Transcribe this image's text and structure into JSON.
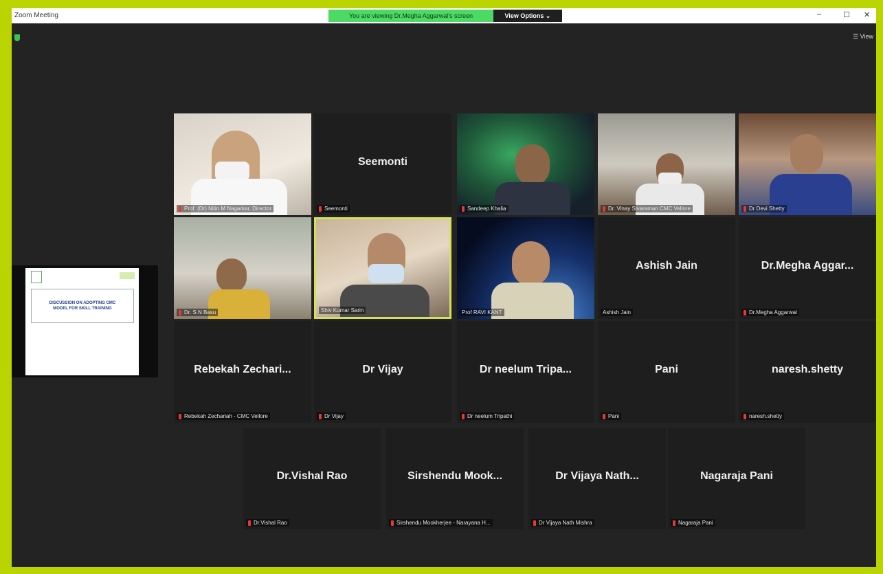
{
  "window": {
    "title": "Zoom Meeting",
    "share_banner": "You are viewing Dr.Megha Aggarwal's screen",
    "view_options": "View Options ⌄",
    "minimize": "–",
    "maximize": "☐",
    "close": "✕",
    "view_label": "☰ View"
  },
  "shared_slide": {
    "title": "DISCUSSION ON ADOPTING CMC MODEL FOR SKILL TRAINING"
  },
  "participants": [
    {
      "label": "Prof. (Dr) Nitin M Nagarkar, Director",
      "mic_muted": true
    },
    {
      "display": "Seemonti",
      "label": "Seemonti",
      "mic_muted": true
    },
    {
      "label": "Sandeep Khalia",
      "mic_muted": true
    },
    {
      "label": "Dr. Vinay Sivaraman CMC Vellore",
      "mic_muted": true
    },
    {
      "label": "Dr Devi Shetty",
      "mic_muted": true
    },
    {
      "label": "Dr. S N Basu",
      "mic_muted": true
    },
    {
      "label": "Shiv Kumar Sarin",
      "mic_muted": false
    },
    {
      "label": "Prof RAVI KANT",
      "mic_muted": false
    },
    {
      "display": "Ashish Jain",
      "label": "Ashish Jain",
      "mic_muted": false
    },
    {
      "display": "Dr.Megha Aggar...",
      "label": "Dr.Megha Aggarwal",
      "mic_muted": true
    },
    {
      "display": "Rebekah Zechari...",
      "label": "Rebekah Zechariah - CMC Vellore",
      "mic_muted": true
    },
    {
      "display": "Dr Vijay",
      "label": "Dr Vijay",
      "mic_muted": true
    },
    {
      "display": "Dr neelum Tripa...",
      "label": "Dr neelum Tripathi",
      "mic_muted": true
    },
    {
      "display": "Pani",
      "label": "Pani",
      "mic_muted": true
    },
    {
      "display": "naresh.shetty",
      "label": "naresh.shetty",
      "mic_muted": true
    },
    {
      "display": "Dr.Vishal Rao",
      "label": "Dr.Vishal Rao",
      "mic_muted": true
    },
    {
      "display": "Sirshendu Mook...",
      "label": "Sirshendu Mookherjee - Narayana H...",
      "mic_muted": true
    },
    {
      "display": "Dr Vijaya Nath...",
      "label": "Dr Vijaya Nath Mishra",
      "mic_muted": true
    },
    {
      "display": "Nagaraja Pani",
      "label": "Nagaraja Pani",
      "mic_muted": true
    }
  ],
  "colors": {
    "accent_border": "#b9d400",
    "active_speaker": "#d4e157",
    "banner_green": "#4cd964",
    "muted_red": "#e53935"
  }
}
